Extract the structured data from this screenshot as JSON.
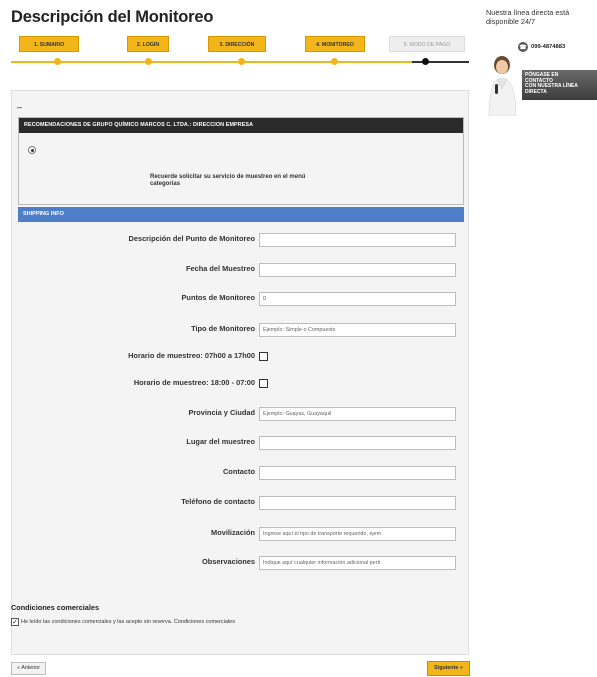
{
  "page": {
    "title": "Descripción del Monitoreo"
  },
  "steps": [
    {
      "label": "1. SUMARIO",
      "state": "active"
    },
    {
      "label": "2. LOGIN",
      "state": "active"
    },
    {
      "label": "3. DIRECCIÓN",
      "state": "active"
    },
    {
      "label": "4. MONITOREO",
      "state": "active"
    },
    {
      "label": "5. MODO DE PAGO",
      "state": "inactive"
    }
  ],
  "right_panel": {
    "line1": "Nuestra línea directa está",
    "line2": "disponible 24/7",
    "phone": "099-4874883",
    "contact_lines": [
      "PÓNGASE EN",
      "CONTACTO",
      "CON NUESTRA LÍNEA",
      "DIRECTA"
    ]
  },
  "main": {
    "dash": "–",
    "recommendations_header": "RECOMENDACIONES DE GRUPO QUÍMICO MARCOS C. LTDA.: DIRECCION EMPRESA",
    "recommendation_line1": "Recuerde solicitar su servicio de muestreo en el menú",
    "recommendation_line2": "categorías",
    "shipping_header": "SHIPPING INFO"
  },
  "form": {
    "fields": [
      {
        "label": "Descripción del Punto de Monitoreo",
        "type": "text",
        "value": "",
        "placeholder": ""
      },
      {
        "label": "Fecha del Muestreo",
        "type": "text",
        "value": "",
        "placeholder": ""
      },
      {
        "label": "Puntos de Monitoreo",
        "type": "text",
        "value": "0",
        "placeholder": ""
      },
      {
        "label": "Tipo de Monitoreo",
        "type": "text",
        "value": "",
        "placeholder": "Ejemplo: Simple o Compuesto"
      },
      {
        "label": "Horario de muestreo: 07h00 a 17h00",
        "type": "checkbox",
        "value": "",
        "placeholder": ""
      },
      {
        "label": "Horario de muestreo: 18:00 - 07:00",
        "type": "checkbox",
        "value": "",
        "placeholder": ""
      },
      {
        "label": "Provincia y Ciudad",
        "type": "text",
        "value": "",
        "placeholder": "Ejemplo: Guayas, Guayaquil"
      },
      {
        "label": "Lugar del muestreo",
        "type": "text",
        "value": "",
        "placeholder": ""
      },
      {
        "label": "Contacto",
        "type": "text",
        "value": "",
        "placeholder": ""
      },
      {
        "label": "Teléfono de contacto",
        "type": "text",
        "value": "",
        "placeholder": ""
      },
      {
        "label": "Movilización",
        "type": "text",
        "value": "",
        "placeholder": "Ingrese aquí el tipo de transporte requerido, ejem"
      },
      {
        "label": "Observaciones",
        "type": "text",
        "value": "",
        "placeholder": "Indique aquí cualquier información adicional perti"
      }
    ]
  },
  "conditions": {
    "title": "Condiciones comerciales",
    "checkbox_text": "He leído las condiciones comerciales y las acepto sin reserva. Condiciones comerciales",
    "checked": true
  },
  "nav": {
    "prev_label": "« Anterior",
    "next_label": "Siguiente »"
  },
  "colors": {
    "accent_yellow": "#f3b61a",
    "header_dark": "#2b2b2b",
    "header_blue": "#4f7ec8"
  }
}
